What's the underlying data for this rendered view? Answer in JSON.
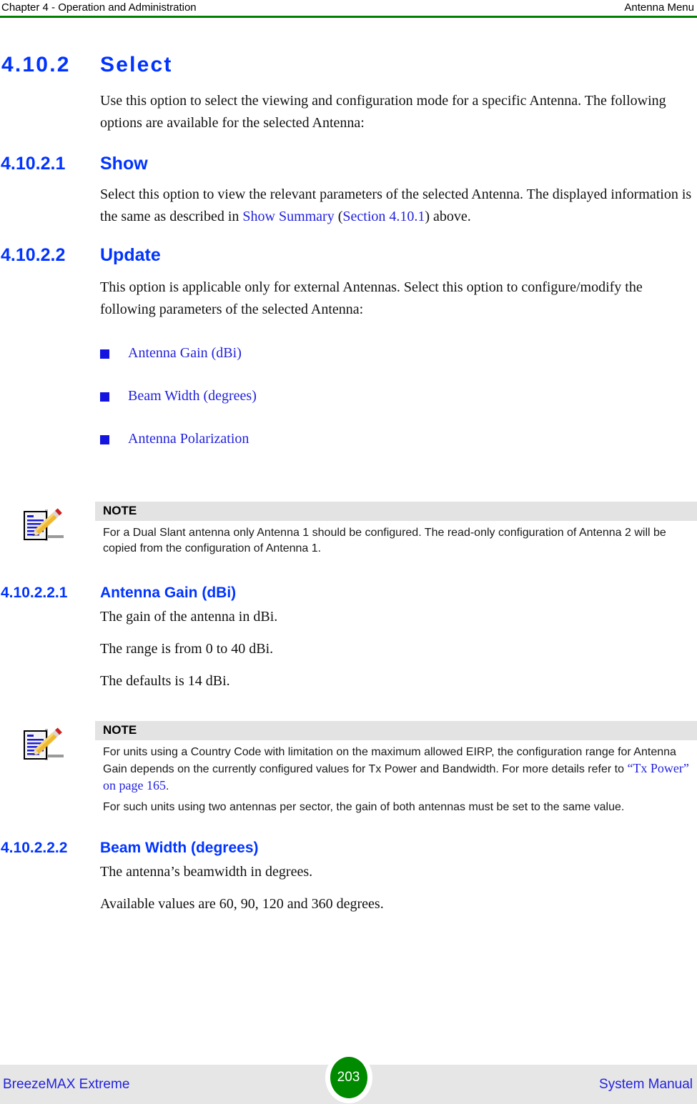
{
  "header": {
    "left": "Chapter 4 - Operation and Administration",
    "right": "Antenna Menu",
    "rule_color": "#008000"
  },
  "section": {
    "number": "4.10.2",
    "title": "Select",
    "intro": "Use this option to select the viewing and configuration mode for a specific Antenna. The following options are available for the selected Antenna:"
  },
  "show": {
    "number": "4.10.2.1",
    "title": "Show",
    "para_part1": "Select this option to view the relevant parameters of the selected Antenna. The displayed information is the same as described in ",
    "link1": "Show Summary",
    "para_part2": " (",
    "link2": "Section 4.10.1",
    "para_part3": ") above."
  },
  "update": {
    "number": "4.10.2.2",
    "title": "Update",
    "para": "This option is applicable only for external Antennas. Select this option to configure/modify the following parameters of the selected Antenna:",
    "bullets": [
      {
        "label": "Antenna Gain (dBi)"
      },
      {
        "label": "Beam Width (degrees)"
      },
      {
        "label": "Antenna Polarization"
      }
    ]
  },
  "note1": {
    "heading": "NOTE",
    "paragraphs": [
      "For a Dual Slant antenna only Antenna 1 should be configured. The read-only configuration of Antenna 2 will be copied from the configuration of Antenna 1."
    ]
  },
  "antenna_gain": {
    "number": "4.10.2.2.1",
    "title": "Antenna Gain (dBi)",
    "para1": "The gain of the antenna in dBi.",
    "para2": "The range is from 0 to 40 dBi.",
    "para3": "The defaults is 14 dBi."
  },
  "note2": {
    "heading": "NOTE",
    "para1_part1": "For units using a Country Code with limitation on the maximum allowed EIRP, the configuration range for Antenna Gain depends on the currently configured values for Tx Power and Bandwidth. For more details refer to ",
    "para1_link": "“Tx Power” on page 165",
    "para1_part2": ".",
    "para2": "For such units using two antennas per sector, the gain of both antennas must be set to the same value."
  },
  "beam_width": {
    "number": "4.10.2.2.2",
    "title": "Beam Width (degrees)",
    "para1": "The antenna’s beamwidth in degrees.",
    "para2": "Available values are 60, 90, 120 and 360 degrees."
  },
  "footer": {
    "left": "BreezeMAX Extreme",
    "page_number": "203",
    "right": "System Manual",
    "badge_color": "#008a00"
  },
  "icons": {
    "note": "notepad-pencil-icon"
  }
}
